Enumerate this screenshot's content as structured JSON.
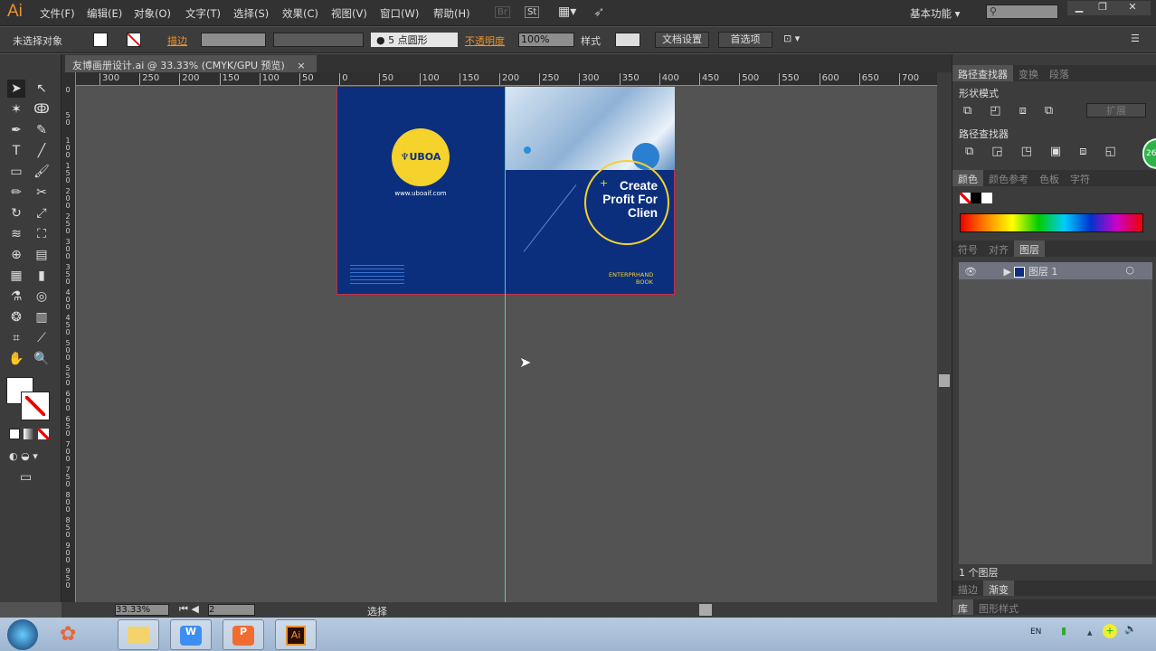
{
  "app": {
    "logo": "Ai",
    "menus": [
      "文件(F)",
      "编辑(E)",
      "对象(O)",
      "文字(T)",
      "选择(S)",
      "效果(C)",
      "视图(V)",
      "窗口(W)",
      "帮助(H)"
    ],
    "bridge": "Br",
    "stock": "St",
    "workspace": "基本功能",
    "search_placeholder": ""
  },
  "control": {
    "selection": "未选择对象",
    "stroke_label": "描边",
    "brush": "5 点圆形",
    "opacity_label": "不透明度",
    "opacity": "100%",
    "style_label": "样式",
    "doc_setup": "文档设置",
    "prefs": "首选项"
  },
  "document": {
    "tab": "友博画册设计.ai @ 33.33% (CMYK/GPU 预览)",
    "close": "×"
  },
  "ruler": {
    "h": [
      "300",
      "250",
      "200",
      "150",
      "100",
      "50",
      "0",
      "50",
      "100",
      "150",
      "200",
      "250",
      "300",
      "350",
      "400",
      "450",
      "500",
      "550",
      "600",
      "650",
      "700"
    ],
    "v": [
      "0",
      "50",
      "100",
      "150",
      "200",
      "250",
      "300",
      "350",
      "400",
      "450",
      "500",
      "550",
      "600",
      "650",
      "700",
      "750",
      "800",
      "850",
      "900",
      "950"
    ]
  },
  "artwork": {
    "logo_text": "UBOA",
    "website": "www.uboaif.com",
    "headline": [
      "Create",
      "Profit For",
      "Clien"
    ],
    "sub": "ENTERPRHAND",
    "book": "BOOK",
    "colors": {
      "navy": "#0b2f7d",
      "yellow": "#f5d22c"
    }
  },
  "panels": {
    "tabs1": [
      "路径查找器",
      "变换",
      "段落"
    ],
    "shape_modes": "形状模式",
    "expand": "扩展",
    "pathfinders": "路径查找器",
    "tabs2": [
      "颜色",
      "颜色参考",
      "色板",
      "字符"
    ],
    "tabs3": [
      "符号",
      "对齐",
      "图层"
    ],
    "layer_name": "图层 1",
    "layer_count": "1 个图层",
    "tabs4": [
      "描边",
      "渐变"
    ],
    "tabs5": [
      "库",
      "图形样式"
    ],
    "badge": "26"
  },
  "status": {
    "zoom": "33.33%",
    "artboard": "2",
    "tool": "选择"
  },
  "taskbar": {
    "lang": "EN",
    "apps": [
      "explorer",
      "wps-writer",
      "wps-presentation",
      "illustrator"
    ],
    "illustrator_label": "Ai"
  }
}
